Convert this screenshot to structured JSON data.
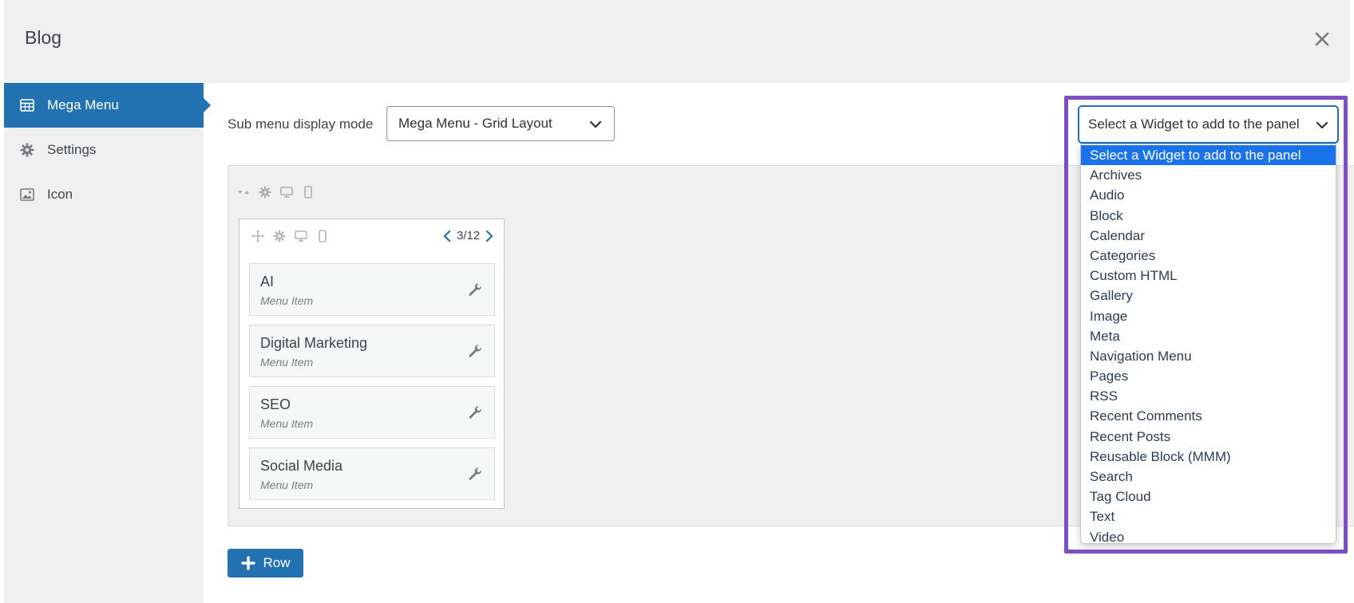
{
  "modal": {
    "title": "Blog",
    "close_icon": "close-icon"
  },
  "sidebar": {
    "items": [
      {
        "label": "Mega Menu",
        "icon": "table-icon",
        "active": true
      },
      {
        "label": "Settings",
        "icon": "gear-icon",
        "active": false
      },
      {
        "label": "Icon",
        "icon": "image-icon",
        "active": false
      }
    ]
  },
  "display_mode": {
    "label": "Sub menu display mode",
    "selected": "Mega Menu - Grid Layout"
  },
  "column": {
    "span": "3/12",
    "items": [
      {
        "title": "AI",
        "type": "Menu Item"
      },
      {
        "title": "Digital Marketing",
        "type": "Menu Item"
      },
      {
        "title": "SEO",
        "type": "Menu Item"
      },
      {
        "title": "Social Media",
        "type": "Menu Item"
      }
    ]
  },
  "add_row": {
    "label": "Row"
  },
  "widget_select": {
    "selected": "Select a Widget to add to the panel",
    "options": [
      "Select a Widget to add to the panel",
      "Archives",
      "Audio",
      "Block",
      "Calendar",
      "Categories",
      "Custom HTML",
      "Gallery",
      "Image",
      "Meta",
      "Navigation Menu",
      "Pages",
      "RSS",
      "Recent Comments",
      "Recent Posts",
      "Reusable Block (MMM)",
      "Search",
      "Tag Cloud",
      "Text",
      "Video"
    ]
  },
  "colors": {
    "accent": "#2271b1",
    "highlight": "#7e4fc4",
    "option_selected": "#1a73e8"
  }
}
